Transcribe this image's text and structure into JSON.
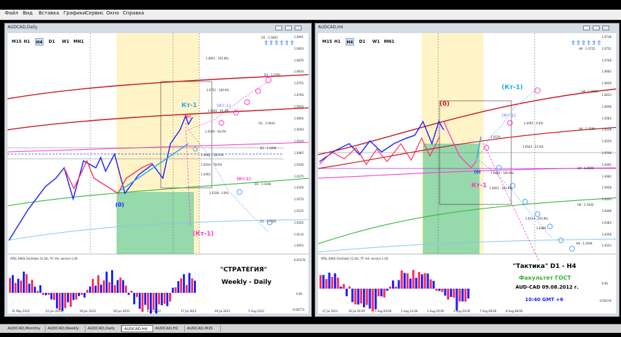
{
  "menu": [
    "Файл",
    "Вид",
    "Вставка",
    "Графики",
    "Сервис",
    "Окно",
    "Справка"
  ],
  "timeframes": [
    "M15",
    "H1",
    "H4",
    "D1",
    "W1",
    "MN1"
  ],
  "left_window": {
    "title": "AUDCAD,Daily",
    "active_tf": "H4",
    "prices": [
      "1.0941",
      "1.0920",
      "1.0870",
      "1.0810",
      "1.0755",
      "1.0700",
      "1.0650",
      "1.0600",
      "1.0544",
      "1.0529",
      "1.0485",
      "1.0430",
      "1.0375",
      "1.0320",
      "1.0270",
      "1.0215",
      "1.0165",
      "1.0110",
      "1.0055"
    ],
    "date_labels": [
      "31 May 2012",
      "12 Jun 2012",
      "19 Jun 2012",
      "28 Jun 2012",
      "9 Jul 2012",
      "17 Jul 2012",
      "26 Jul 2012",
      "5 Aug 2012"
    ],
    "fib_labels": [
      "D1 - 1.0941",
      "1.0851 - 161.8%",
      "D1 - 1.0792",
      "1.0751 - 100.0%",
      "1.0641 - 61.8%",
      "D1 - 1.0643",
      "1.0549 - 50.0%",
      "D1 - 1.0494",
      "1.0492 - 100.0%",
      "1.0430 - 78.6%",
      "1.0392",
      "D1 - 1.0348",
      "1.0338 - 0.0%",
      "D1 - 1.0185"
    ],
    "waves": [
      "Кт-1",
      "(Кт-1)",
      "(Кт-1)",
      "(0)",
      "(0)",
      "(Кт-1)"
    ],
    "oscillator_label": "ATEL SAKS Oscillator (5,34). TF: H4. version 1.00",
    "osc_values": [
      "0.01576",
      "0.00",
      "-0.00773"
    ],
    "strategy_title": "\"СТРАТЕГИЯ\"",
    "strategy_sub": "Weekly - Daily"
  },
  "right_window": {
    "title": "AUDCAD,H4",
    "active_tf": "H4",
    "prices": [
      "1.0738",
      "1.0731",
      "1.0708",
      "1.0683",
      "1.0656",
      "1.0633",
      "1.0608",
      "1.0583",
      "1.0558",
      "1.0529",
      "1.0508",
      "1.0492",
      "1.0483",
      "1.0458",
      "1.0433",
      "1.0408",
      "1.0383",
      "1.0358",
      "1.0333"
    ],
    "date_labels": [
      "27 Jul 2012",
      "30 Jul 20:00",
      "1 Aug 04:00",
      "1 Aug 12:00",
      "2 Aug 20:00",
      "3 Aug 20:00",
      "7 Aug 08:00",
      "8 Aug 08:00"
    ],
    "fib_labels": [
      "H4 - 1.0731",
      "H4 - 1.0656",
      "H4 - 1.0580",
      "1.0565 - 0.0%",
      "1.0570",
      "1.0544 - 23.6%",
      "H4 - 1.0500",
      "1.0486 - 100.0%",
      "1.0453 - 161.8%",
      "H4 - 1.0432",
      "1.0414 - 261.8%",
      "1.0389",
      "H4 - 1.0364"
    ],
    "waves": [
      "(0)",
      "(Кт-1)",
      "Кт-1",
      "(0)",
      "(Кт-1)"
    ],
    "oscillator_label": "ATEL SAKS Oscillator (5,34). TF: H4. version 1.00",
    "osc_values": [
      "0.00",
      "-0.00219"
    ],
    "tactic_title": "\"Тактика\"   D1 - H4",
    "faculty": "Факультет ГОСТ",
    "pair_date": "AUD-CAD 09.08.2012  г.",
    "time": "10:40    GMT +6"
  },
  "taskbar": [
    "AUDCAD,Monthly",
    "AUDCAD,Weekly",
    "AUDCAD,Daily",
    "AUDCAD,H4",
    "AUDCAD,H1",
    "AUDCAD,M15"
  ],
  "taskbar_active": "AUDCAD,H4",
  "colors": {
    "bull": "#1e24ff",
    "bear": "#ff2f5a",
    "cyan": "#1faeeb",
    "magenta": "#ff3cc8",
    "green_zone": "#96d9aa",
    "yellow_zone": "#fff4c8",
    "red_ma": "#c8141e",
    "green_ma": "#32b432",
    "purple_ma": "#9b2df7"
  }
}
